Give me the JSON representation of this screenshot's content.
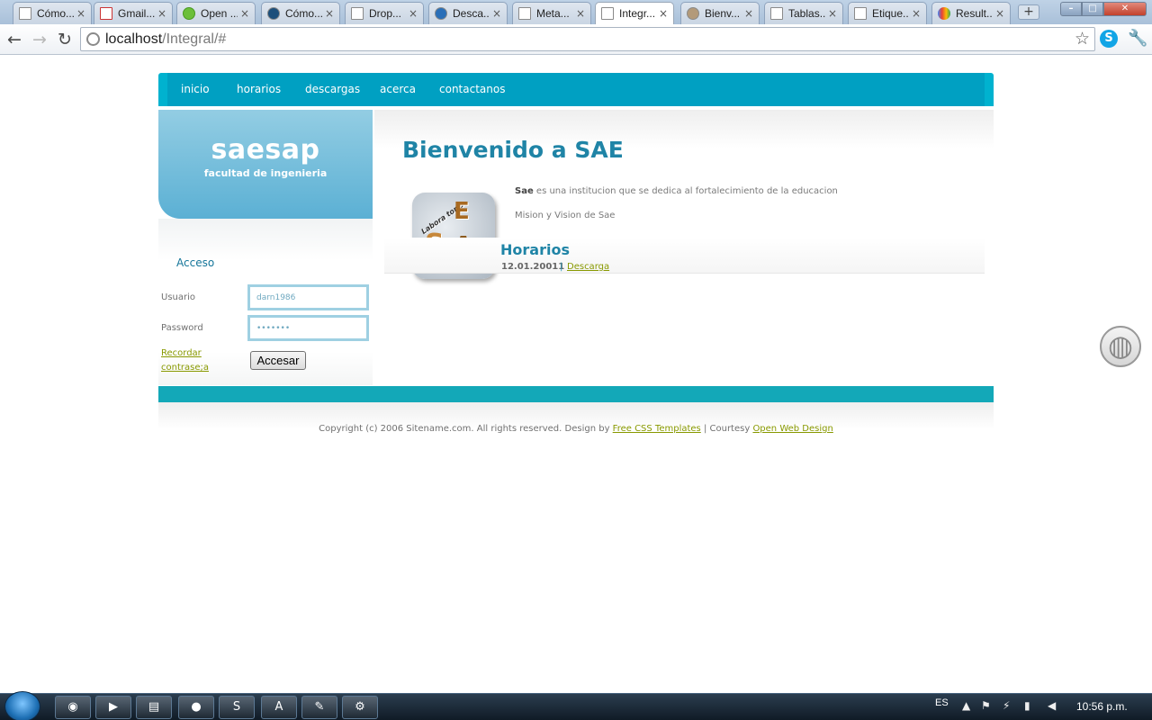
{
  "browser": {
    "tabs": [
      {
        "label": "Cómo...",
        "icon": "page-icon"
      },
      {
        "label": "Gmail...",
        "icon": "gmail-icon"
      },
      {
        "label": "Open ...",
        "icon": "leaf-icon"
      },
      {
        "label": "Cómo...",
        "icon": "eye-icon"
      },
      {
        "label": "Drop...",
        "icon": "page-icon"
      },
      {
        "label": "Desca...",
        "icon": "people-icon"
      },
      {
        "label": "Meta...",
        "icon": "page-icon"
      },
      {
        "label": "Integr...",
        "icon": "page-icon"
      },
      {
        "label": "Bienv...",
        "icon": "avatar-icon"
      },
      {
        "label": "Tablas...",
        "icon": "page-icon"
      },
      {
        "label": "Etique...",
        "icon": "page-icon"
      },
      {
        "label": "Result...",
        "icon": "google-icon"
      }
    ],
    "active_tab_index": 7,
    "tab_close_glyph": "×",
    "new_tab_glyph": "+",
    "url_host": "localhost",
    "url_path": "/Integral/#"
  },
  "site": {
    "nav": [
      "inicio",
      "horarios",
      "descargas",
      "acerca",
      "contactanos"
    ],
    "title": "saesap",
    "subtitle": "facultad de ingenieria",
    "login": {
      "heading": "Acceso",
      "user_label": "Usuario",
      "user_value": "darn1986",
      "password_label": "Password",
      "password_value": "•••••••",
      "remember_line1": "Recordar",
      "remember_line2": "contrase;a",
      "button_label": "Accesar"
    },
    "welcome_title": "Bienvenido a SAE",
    "intro_bold": "Sae",
    "intro_rest": " es una institucion que se dedica al fortalecimiento de la educacion",
    "mission": "Mision y Vision de Sae",
    "schedule": {
      "title": "Horarios",
      "date": "12.01.20011",
      "separator": "|",
      "link": "Descarga"
    },
    "logo_letters": {
      "e": "E",
      "s": "S",
      "a": "A",
      "text": "Labora torio"
    },
    "footer": {
      "prefix": "Copyright (c) 2006 Sitename.com. All rights reserved. Design by ",
      "link1": "Free CSS Templates",
      "middle": " | Courtesy ",
      "link2": "Open Web Design"
    }
  },
  "taskbar": {
    "language": "ES",
    "clock": "10:56 p.m."
  },
  "colors": {
    "nav_bar": "#00a0c2",
    "heading_blue": "#1f84a6",
    "link_olive": "#889900",
    "footer_bar": "#13a8b8"
  }
}
